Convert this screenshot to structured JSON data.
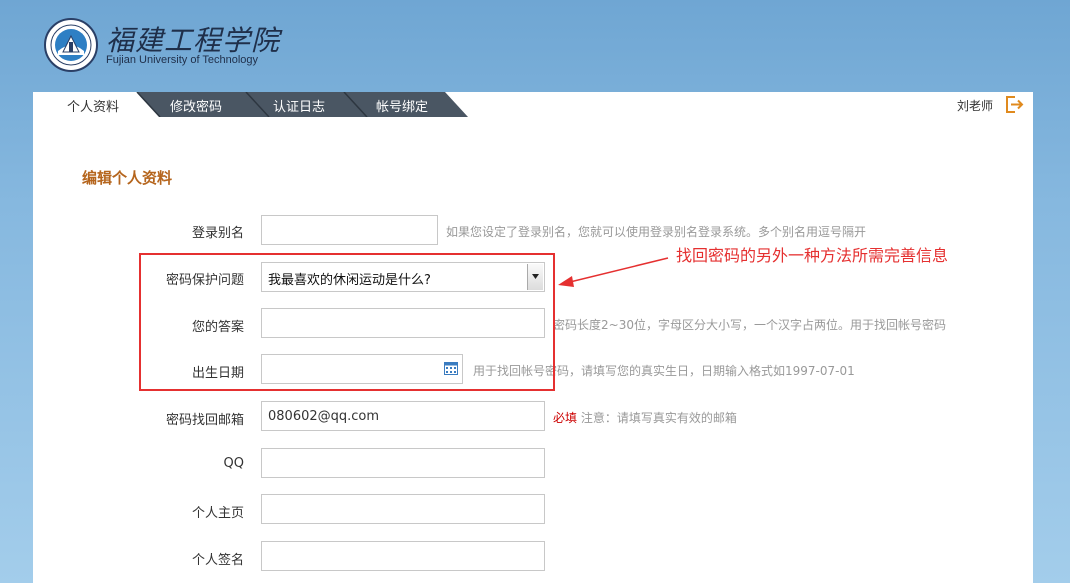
{
  "school": {
    "name_cn": "福建工程学院",
    "name_en": "Fujian University of Technology"
  },
  "tabs": [
    {
      "label": "个人资料",
      "active": true
    },
    {
      "label": "修改密码",
      "active": false
    },
    {
      "label": "认证日志",
      "active": false
    },
    {
      "label": "帐号绑定",
      "active": false
    }
  ],
  "user": {
    "name": "刘老师",
    "logout_icon": "logout-icon"
  },
  "section_title": "编辑个人资料",
  "form": {
    "alias": {
      "label": "登录别名",
      "value": "",
      "hint": "如果您设定了登录别名，您就可以使用登录别名登录系统。多个别名用逗号隔开"
    },
    "question": {
      "label": "密码保护问题",
      "selected": "我最喜欢的休闲运动是什么?"
    },
    "answer": {
      "label": "您的答案",
      "value": "",
      "hint": "密码长度2~30位，字母区分大小写，一个汉字占两位。用于找回帐号密码"
    },
    "birthday": {
      "label": "出生日期",
      "value": "",
      "hint": "用于找回帐号密码，请填写您的真实生日，日期输入格式如1997-07-01",
      "icon": "calendar-icon"
    },
    "email": {
      "label": "密码找回邮箱",
      "value": "080602@qq.com",
      "required": "必填",
      "hint": "注意：请填写真实有效的邮箱"
    },
    "qq": {
      "label": "QQ",
      "value": ""
    },
    "homepage": {
      "label": "个人主页",
      "value": ""
    },
    "signature": {
      "label": "个人签名",
      "value": ""
    }
  },
  "annotation": {
    "text": "找回密码的另外一种方法所需完善信息",
    "color": "#e53030"
  },
  "colors": {
    "title": "#b5651d",
    "tab_dark": "#4a5663",
    "accent_orange": "#e08a1e"
  }
}
